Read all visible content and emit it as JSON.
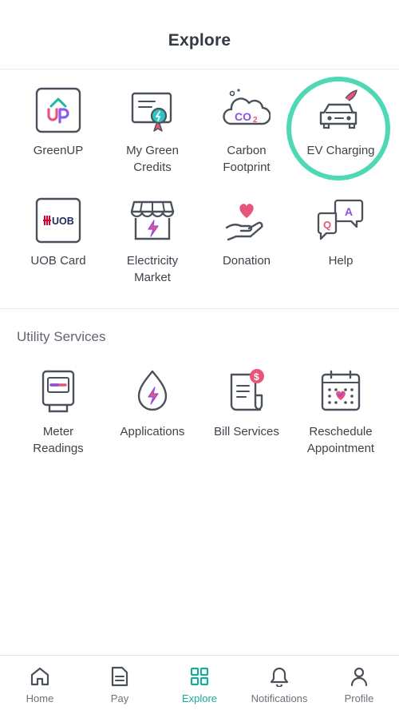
{
  "header": {
    "title": "Explore"
  },
  "top_grid": [
    {
      "label": "GreenUP",
      "icon": "greenup-logo-icon"
    },
    {
      "label": "My Green\nCredits",
      "icon": "certificate-icon"
    },
    {
      "label": "Carbon\nFootprint",
      "icon": "co2-cloud-icon"
    },
    {
      "label": "EV Charging",
      "icon": "electric-car-icon"
    },
    {
      "label": "UOB Card",
      "icon": "uob-card-icon",
      "badge": "UOB"
    },
    {
      "label": "Electricity\nMarket",
      "icon": "market-stall-icon"
    },
    {
      "label": "Donation",
      "icon": "heart-hand-icon"
    },
    {
      "label": "Help",
      "icon": "chat-bubbles-icon"
    }
  ],
  "utility": {
    "title": "Utility Services",
    "items": [
      {
        "label": "Meter\nReadings",
        "icon": "meter-icon"
      },
      {
        "label": "Applications",
        "icon": "energy-drop-icon"
      },
      {
        "label": "Bill Services",
        "icon": "bill-icon"
      },
      {
        "label": "Reschedule\nAppointment",
        "icon": "calendar-icon"
      }
    ]
  },
  "tabs": [
    {
      "label": "Home",
      "icon": "home-icon",
      "active": false
    },
    {
      "label": "Pay",
      "icon": "document-icon",
      "active": false
    },
    {
      "label": "Explore",
      "icon": "grid-icon",
      "active": true
    },
    {
      "label": "Notifications",
      "icon": "bell-icon",
      "active": false
    },
    {
      "label": "Profile",
      "icon": "person-icon",
      "active": false
    }
  ],
  "colors": {
    "accent": "#1ba99a",
    "highlight_ring": "#4ed8b6",
    "icon_stroke": "#4a515b"
  }
}
